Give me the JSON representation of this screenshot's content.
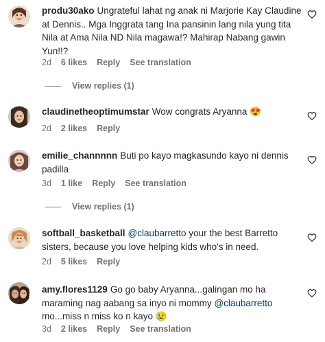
{
  "comments": [
    {
      "username": "produ30ako",
      "text": "Ungrateful lahat ng anak ni Marjorie Kay Claudine at Dennis.. Mga Inggrata tang Ina pansinin lang nila yung tita Nila at Ama Nila ND Nila magawa!? Mahirap Nabang gawin Yun!!?",
      "age": "2d",
      "likes": "6 likes",
      "reply": "Reply",
      "translate": "See translation",
      "view_replies": "View replies (1)"
    },
    {
      "username": "claudinetheoptimumstar",
      "text": "Wow congrats Aryanna",
      "emoji": "😍",
      "age": "2d",
      "likes": "2 likes",
      "reply": "Reply"
    },
    {
      "username": "emilie_channnnn",
      "text": "Buti po kayo magkasundo kayo ni dennis padilla",
      "age": "3d",
      "likes": "1 like",
      "reply": "Reply",
      "translate": "See translation",
      "view_replies": "View replies (1)"
    },
    {
      "username": "softball_basketball",
      "mention": "@claubarretto",
      "text": " your the best Barretto sisters, because you love helping kids who's in need.",
      "age": "2d",
      "likes": "5 likes",
      "reply": "Reply"
    },
    {
      "username": "amy.flores1129",
      "text_a": "Go go baby Aryanna...galingan mo ha maraming nag aabang sa inyo ni mommy ",
      "mention": "@claubarretto",
      "text_b": " mo...miss n miss ko n kayo ",
      "emoji": "😢",
      "age": "3d",
      "likes": "2 likes",
      "reply": "Reply",
      "translate": "See translation"
    }
  ],
  "icons": {
    "like": "heart-outline-icon"
  },
  "colors": {
    "text": "#262626",
    "secondary": "#737373",
    "mention": "#00376b"
  }
}
